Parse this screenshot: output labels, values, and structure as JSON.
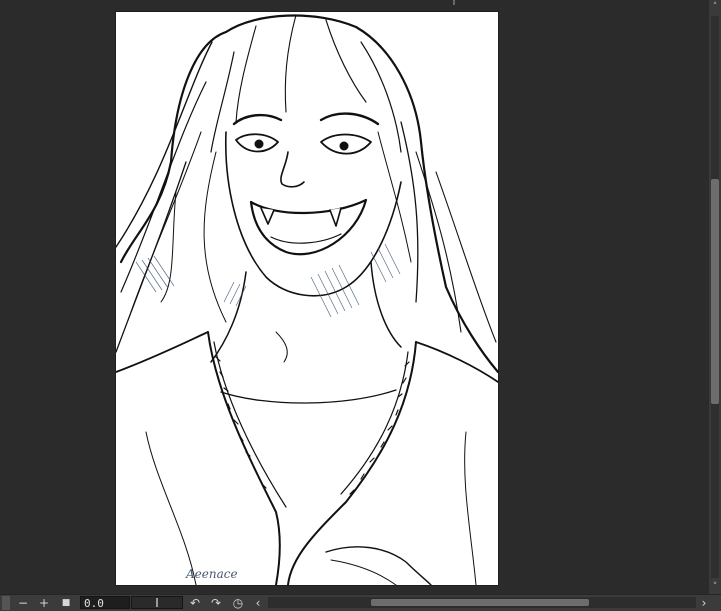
{
  "canvas": {
    "artwork": "ink-sketch-illustration",
    "signature_text": "Aeenace"
  },
  "statusbar": {
    "zoom_out_label": "−",
    "zoom_in_label": "+",
    "fit_label": "■",
    "rotation_value": "0.0",
    "rotate_left_label": "↶",
    "rotate_right_label": "↷",
    "reset_rotation_label": "◷",
    "scroll_left_label": "‹",
    "scroll_right_label": "›",
    "rotation_slider_fraction": 0.5
  },
  "scrollbars": {
    "vertical_thumb_start": 0.29,
    "vertical_thumb_end": 0.69,
    "horizontal_thumb_start": 0.24,
    "horizontal_thumb_end": 0.75,
    "up_label": "˄",
    "down_label": "˅"
  },
  "colors": {
    "workspace": "#2b2b2b",
    "ink": "#111111",
    "shade": "#2f4a6a"
  }
}
